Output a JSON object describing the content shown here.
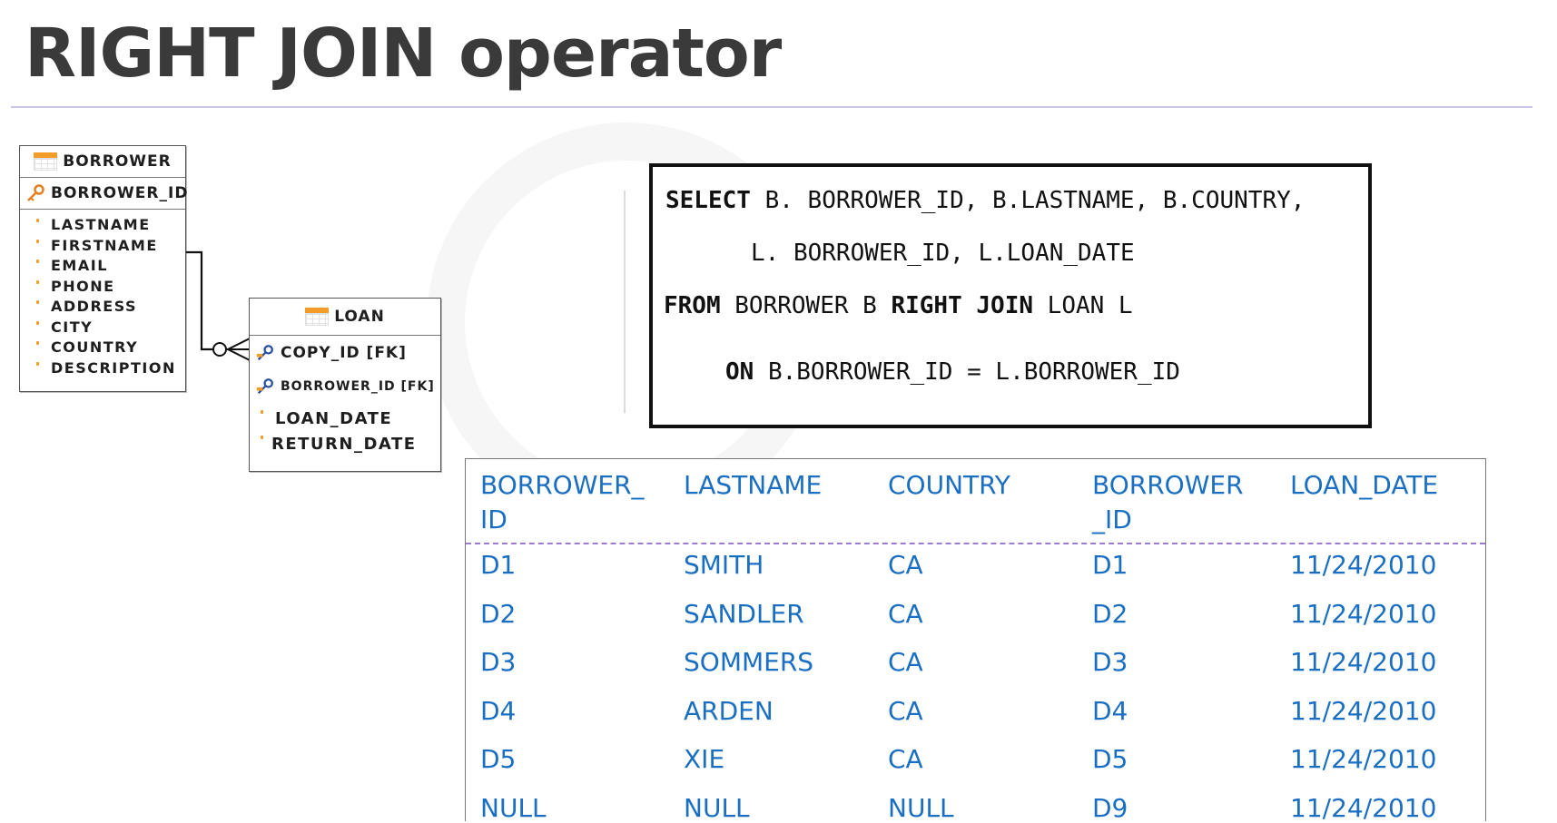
{
  "slide": {
    "title": "RIGHT JOIN operator"
  },
  "diagram": {
    "borrower": {
      "name": "BORROWER",
      "primary_key": "BORROWER_ID",
      "attributes": [
        "LASTNAME",
        "FIRSTNAME",
        "EMAIL",
        "PHONE",
        "ADDRESS",
        "CITY",
        "COUNTRY",
        "DESCRIPTION"
      ]
    },
    "loan": {
      "name": "LOAN",
      "foreign_keys": [
        "COPY_ID [FK]",
        "BORROWER_ID [FK]"
      ],
      "attributes": [
        "LOAN_DATE",
        "RETURN_DATE"
      ]
    },
    "relationship": "one-to-many"
  },
  "sql": {
    "line1_kw": "SELECT",
    "line1_rest": " B. BORROWER_ID, B.LASTNAME, B.COUNTRY,",
    "line2": "L. BORROWER_ID, L.LOAN_DATE",
    "line3_kw1": "FROM",
    "line3_mid1": " BORROWER B ",
    "line3_kw2": "RIGHT JOIN",
    "line3_mid2": " LOAN L",
    "line4_kw": "ON",
    "line4_rest": " B.BORROWER_ID = L.BORROWER_ID"
  },
  "result": {
    "headers": [
      "BORROWER_\nID",
      "LASTNAME",
      "COUNTRY",
      "BORROWER\n_ID",
      "LOAN_DATE"
    ],
    "rows": [
      [
        "D1",
        "SMITH",
        "CA",
        "D1",
        "11/24/2010"
      ],
      [
        "D2",
        "SANDLER",
        "CA",
        "D2",
        "11/24/2010"
      ],
      [
        "D3",
        "SOMMERS",
        "CA",
        "D3",
        "11/24/2010"
      ],
      [
        "D4",
        "ARDEN",
        "CA",
        "D4",
        "11/24/2010"
      ],
      [
        "D5",
        "XIE",
        "CA",
        "D5",
        "11/24/2010"
      ],
      [
        "NULL",
        "NULL",
        "NULL",
        "D9",
        "11/24/2010"
      ]
    ]
  },
  "colors": {
    "result_text": "#1a6fc2",
    "header_rule": "#9c7bd3",
    "icon_orange": "#f39c2a",
    "key_blue": "#2b4fa0"
  }
}
